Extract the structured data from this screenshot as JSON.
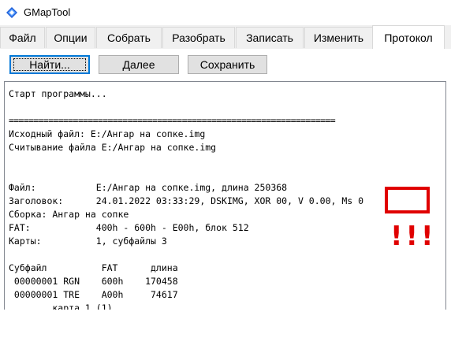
{
  "window": {
    "title": "GMapTool",
    "icon": "gmaptool-diamond-icon"
  },
  "tabs": [
    {
      "label": "Файл",
      "active": false
    },
    {
      "label": "Опции",
      "active": false
    },
    {
      "label": "Собрать",
      "active": false
    },
    {
      "label": "Разобрать",
      "active": false
    },
    {
      "label": "Записать",
      "active": false
    },
    {
      "label": "Изменить",
      "active": false
    },
    {
      "label": "Протокол",
      "active": true
    }
  ],
  "toolbar": {
    "find_label": "Найти...",
    "next_label": "Далее",
    "save_label": "Сохранить"
  },
  "log": {
    "lines": [
      "Старт программы...",
      "",
      "==================================================================",
      "Исходный файл: E:/Ангар на сопке.img",
      "Считывание файла E:/Ангар на сопке.img",
      "",
      "",
      "Файл:           E:/Ангар на сопке.img, длина 250368",
      "Заголовок:      24.01.2022 03:33:29, DSKIMG, XOR 00, V 0.00, Ms 0",
      "Сборка: Ангар на сопке",
      "FAT:            400h - 600h - E00h, блок 512",
      "Карты:          1, субфайлы 3",
      "",
      "Субфайл          FAT      длина",
      " 00000001 RGN    600h    170458",
      " 00000001 TRE    A00h     74617",
      "        карта 1 (1)"
    ]
  },
  "annotation": {
    "exclamation": "!!!",
    "color": "#e00000"
  }
}
